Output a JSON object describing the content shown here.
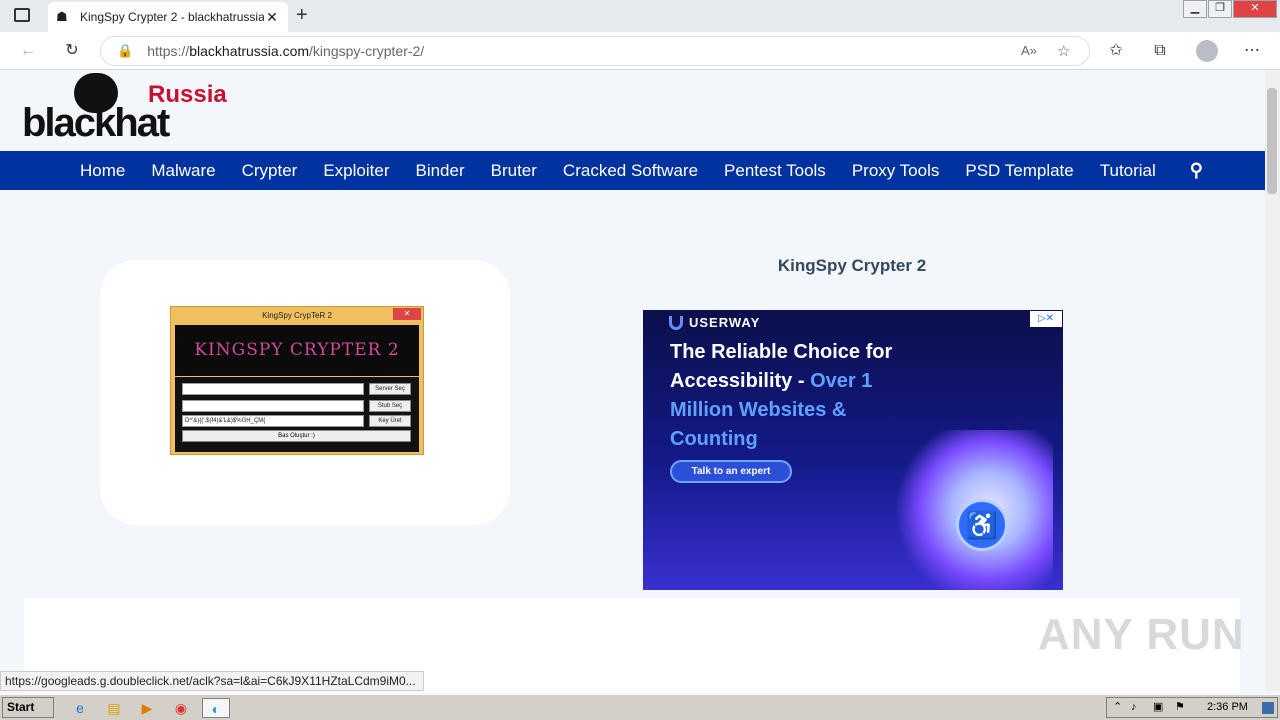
{
  "browser": {
    "tab_title": "KingSpy Crypter 2 - blackhatrussia",
    "tab_close": "✕",
    "new_tab": "+",
    "url_scheme": "https://",
    "url_host": "blackhatrussia.com",
    "url_path": "/kingspy-crypter-2/",
    "status_url": "https://googleads.g.doubleclick.net/aclk?sa=l&ai=C6kJ9X11HZtaLCdm9iM0..."
  },
  "site": {
    "logo_top": "Russia",
    "logo_bottom": "blackhat",
    "menu": [
      "Home",
      "Malware",
      "Crypter",
      "Exploiter",
      "Binder",
      "Bruter",
      "Cracked Software",
      "Pentest Tools",
      "Proxy Tools",
      "PSD Template",
      "Tutorial"
    ],
    "post_title": "KingSpy Crypter 2"
  },
  "app_screenshot": {
    "title": "KingSpy CrypTeR 2",
    "banner": "KINGSPY CRYPTER 2",
    "field3_value": "D^'&){('.$(f4)&'L&)$%GH_ÇM{",
    "buttons": [
      "Server Seç",
      "Stub Seç",
      "Key Üret"
    ],
    "go_button": "Bas Oluştur :)"
  },
  "ad": {
    "brand": "USERWAY",
    "headline_a": "The Reliable Choice for Accessibility - ",
    "headline_b": "Over 1 Million Websites & Counting",
    "cta": "Talk to an expert",
    "choice": "▷✕"
  },
  "watermark": "ANY RUN",
  "taskbar": {
    "start": "Start",
    "clock": "2:36 PM"
  }
}
